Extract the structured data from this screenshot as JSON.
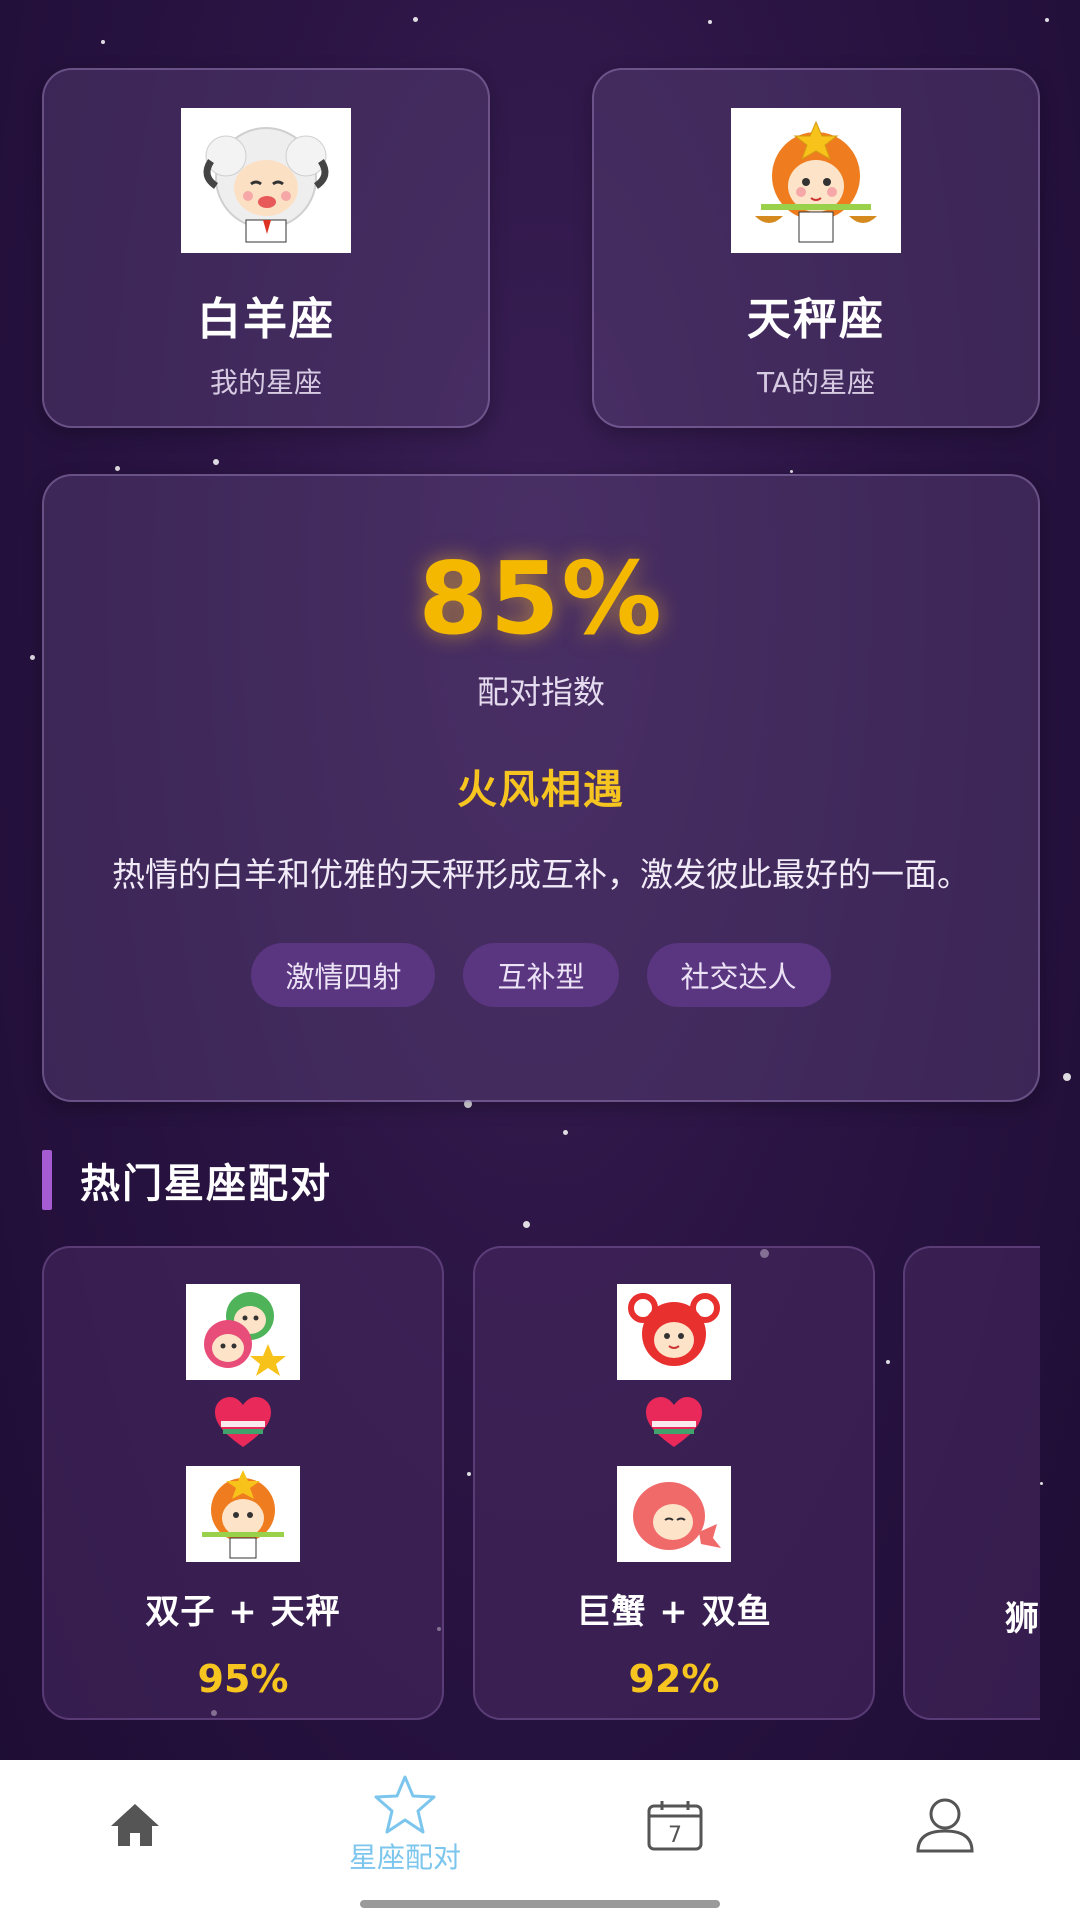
{
  "my_sign": {
    "name": "白羊座",
    "subtitle": "我的星座",
    "avatar_icon": "aries-sheep-avatar"
  },
  "ta_sign": {
    "name": "天秤座",
    "subtitle": "TA的星座",
    "avatar_icon": "libra-avatar"
  },
  "result": {
    "percent": "85%",
    "percent_label": "配对指数",
    "title": "火风相遇",
    "description": "热情的白羊和优雅的天秤形成互补，激发彼此最好的一面。",
    "tags": [
      "激情四射",
      "互补型",
      "社交达人"
    ]
  },
  "popular": {
    "title": "热门星座配对",
    "pairs": [
      {
        "name": "双子 + 天秤",
        "score": "95%"
      },
      {
        "name": "巨蟹 + 双鱼",
        "score": "92%"
      },
      {
        "name": "狮"
      }
    ]
  },
  "tabs": [
    {
      "name": "home",
      "label": "",
      "icon": "home-icon"
    },
    {
      "name": "match",
      "label": "星座配对",
      "icon": "star-icon",
      "active": true
    },
    {
      "name": "calendar",
      "label": "",
      "icon": "calendar-icon",
      "day": "7"
    },
    {
      "name": "profile",
      "label": "",
      "icon": "person-icon"
    }
  ],
  "colors": {
    "accent_gold": "#f7c51f",
    "tab_active": "#7cc6ee",
    "tag_bg": "#5a3580"
  }
}
